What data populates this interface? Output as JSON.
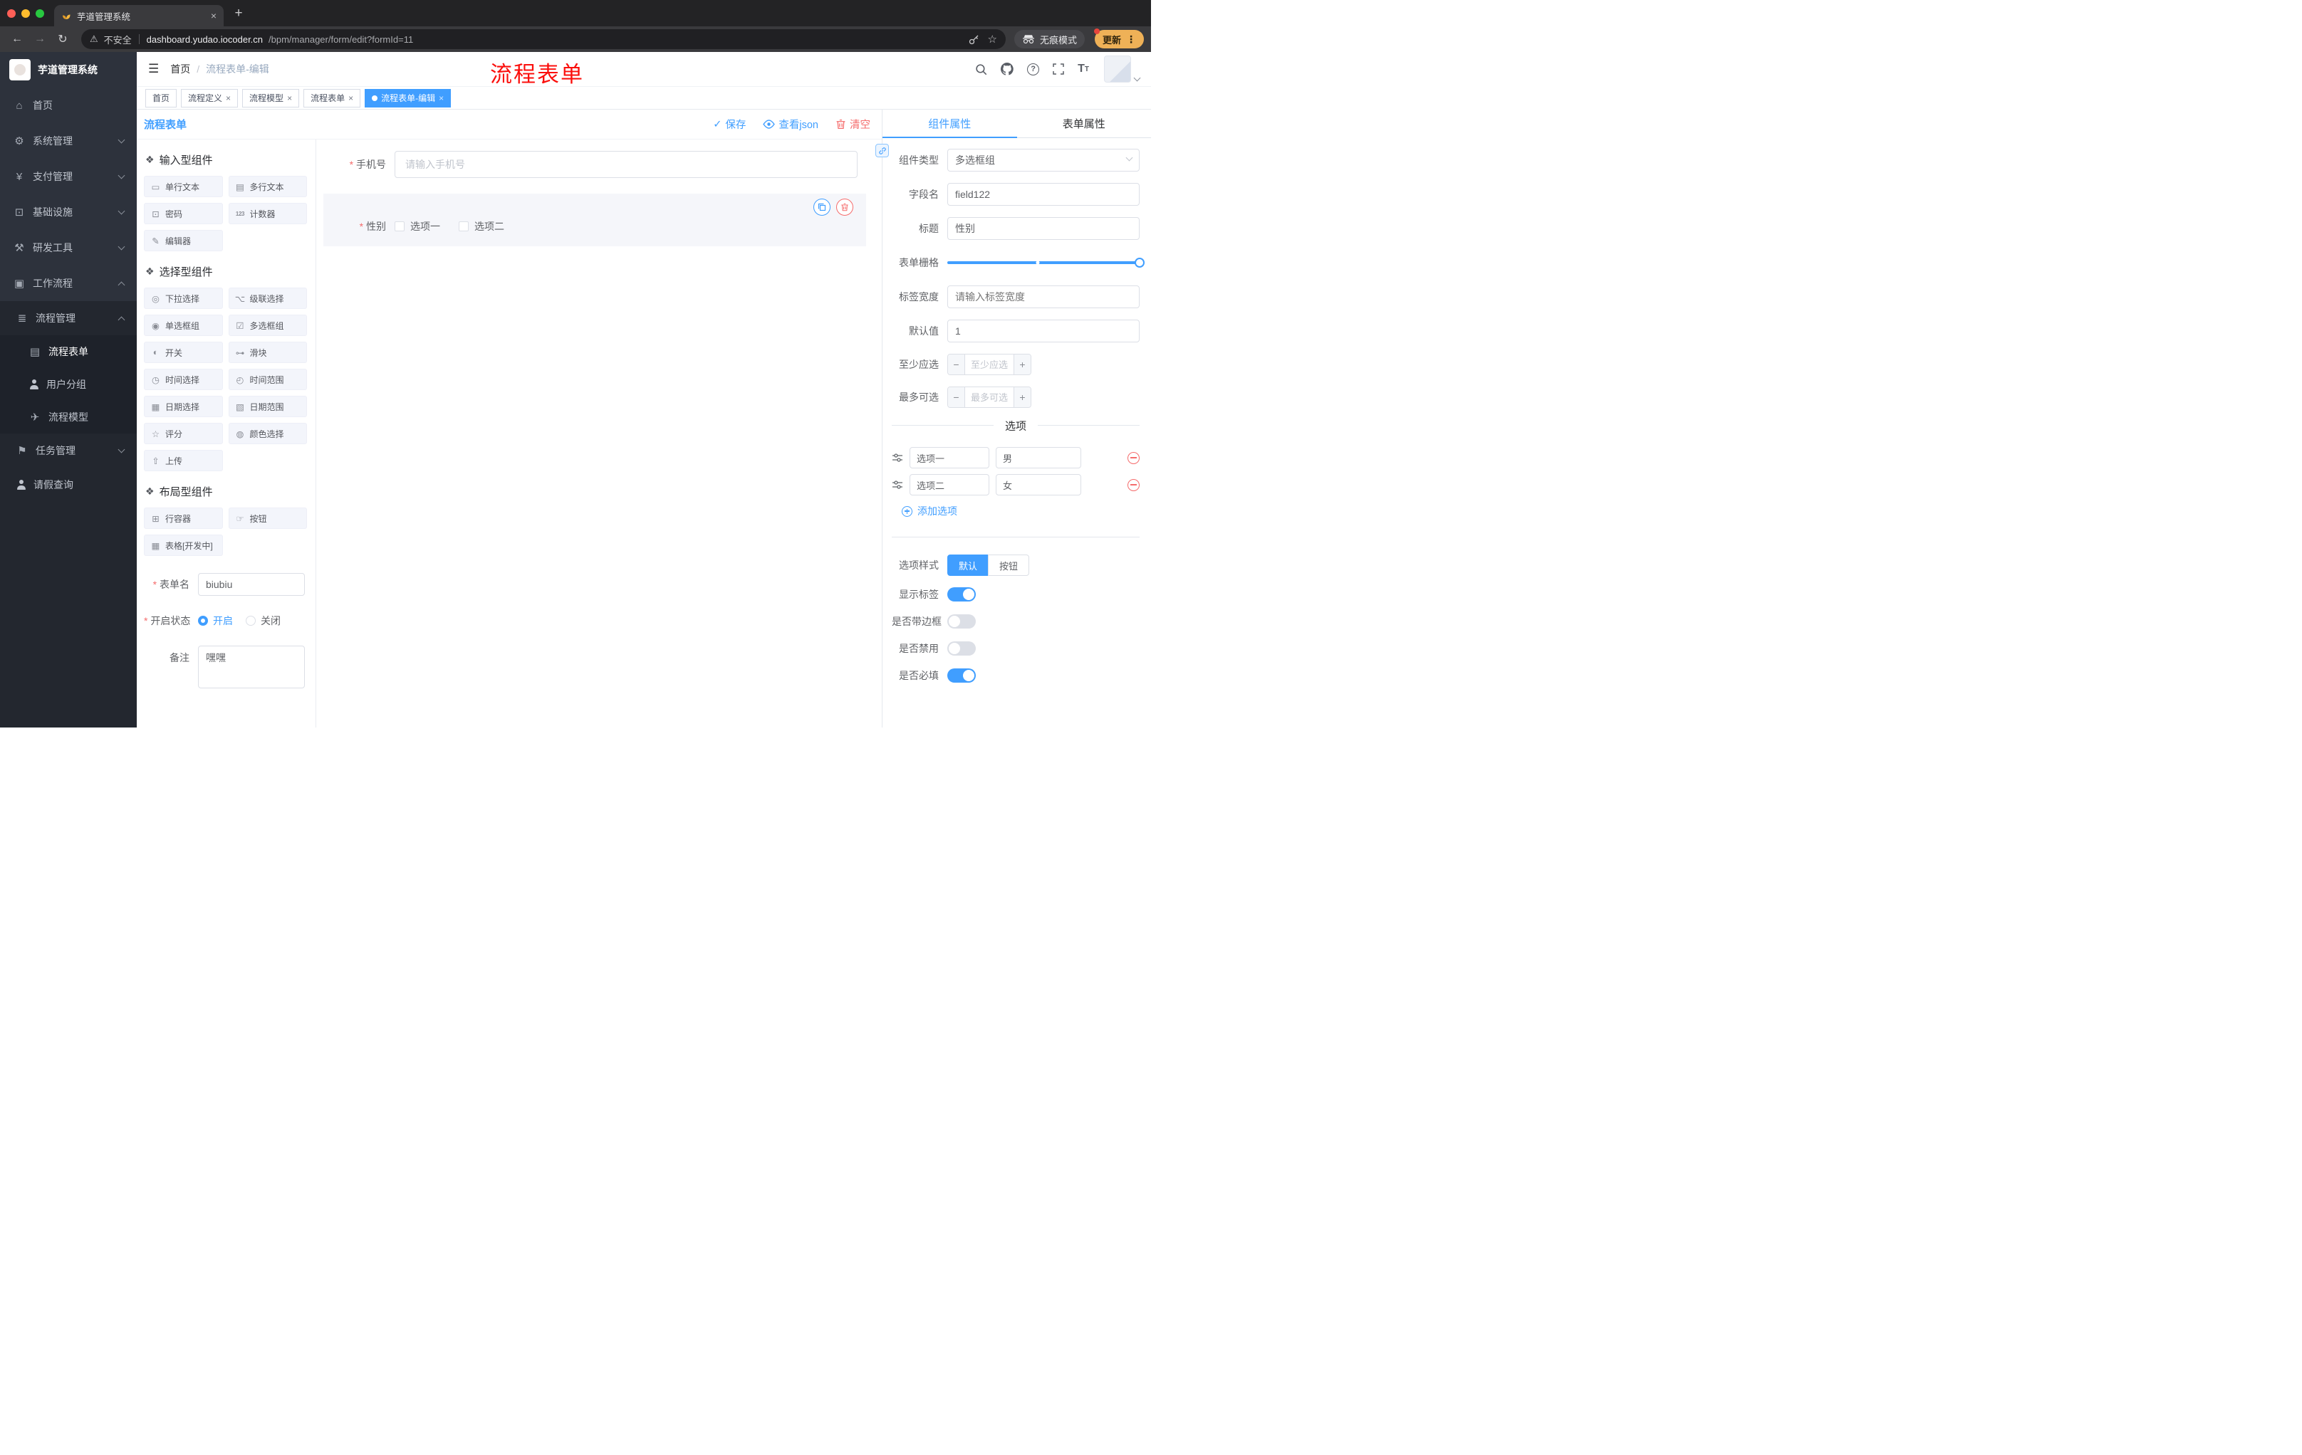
{
  "colors": {
    "accent": "#409eff",
    "danger": "#f56c6c",
    "annotation_red": "#fb0f0c",
    "sidebar_bg": "#2d323c",
    "active_tag_bg": "#409eff",
    "update_pill": "#efb157"
  },
  "browser": {
    "tab_title": "芋道管理系统",
    "security_label": "不安全",
    "url_domain": "dashboard.yudao.iocoder.cn",
    "url_path": "/bpm/manager/form/edit?formId=11",
    "incognito_label": "无痕模式",
    "update_label": "更新"
  },
  "sidebar": {
    "title": "芋道管理系统",
    "items": [
      {
        "label": "首页"
      },
      {
        "label": "系统管理"
      },
      {
        "label": "支付管理"
      },
      {
        "label": "基础设施"
      },
      {
        "label": "研发工具"
      },
      {
        "label": "工作流程"
      }
    ],
    "submenu": {
      "label": "流程管理",
      "children": [
        {
          "label": "流程表单"
        },
        {
          "label": "用户分组"
        },
        {
          "label": "流程模型"
        }
      ]
    },
    "tail": [
      {
        "label": "任务管理"
      },
      {
        "label": "请假查询"
      }
    ]
  },
  "header": {
    "breadcrumb": [
      "首页",
      "流程表单-编辑"
    ],
    "annotation": "流程表单"
  },
  "tags": [
    {
      "label": "首页"
    },
    {
      "label": "流程定义"
    },
    {
      "label": "流程模型"
    },
    {
      "label": "流程表单"
    },
    {
      "label": "流程表单-编辑"
    }
  ],
  "designer": {
    "title": "流程表单",
    "actions": {
      "save": "保存",
      "view_json": "查看json",
      "clear": "清空"
    },
    "palette": {
      "groups": [
        {
          "title": "输入型组件",
          "items": [
            "单行文本",
            "多行文本",
            "密码",
            "计数器",
            "编辑器"
          ]
        },
        {
          "title": "选择型组件",
          "items": [
            "下拉选择",
            "级联选择",
            "单选框组",
            "多选框组",
            "开关",
            "滑块",
            "时间选择",
            "时间范围",
            "日期选择",
            "日期范围",
            "评分",
            "颜色选择",
            "上传"
          ]
        },
        {
          "title": "布局型组件",
          "items": [
            "行容器",
            "按钮",
            "表格[开发中]"
          ]
        }
      ]
    },
    "meta": {
      "name_label": "表单名",
      "name_value": "biubiu",
      "status_label": "开启状态",
      "status_on": "开启",
      "status_off": "关闭",
      "remark_label": "备注",
      "remark_value": "嘿嘿"
    },
    "canvas": {
      "phone_label": "手机号",
      "phone_placeholder": "请输入手机号",
      "gender_label": "性别",
      "gender_options": [
        "选项一",
        "选项二"
      ]
    }
  },
  "props": {
    "tabs": [
      "组件属性",
      "表单属性"
    ],
    "rows": {
      "type_label": "组件类型",
      "type_value": "多选框组",
      "field_label": "字段名",
      "field_value": "field122",
      "title_label": "标题",
      "title_value": "性别",
      "grid_label": "表单栅格",
      "width_label": "标签宽度",
      "width_placeholder": "请输入标签宽度",
      "default_label": "默认值",
      "default_value": "1",
      "min_label": "至少应选",
      "min_placeholder": "至少应选",
      "max_label": "最多可选",
      "max_placeholder": "最多可选"
    },
    "options": {
      "title": "选项",
      "rows": [
        {
          "name": "选项一",
          "value": "男"
        },
        {
          "name": "选项二",
          "value": "女"
        }
      ],
      "add_label": "添加选项"
    },
    "style": {
      "label": "选项样式",
      "options": [
        "默认",
        "按钮"
      ]
    },
    "switches": [
      {
        "label": "显示标签",
        "on": true
      },
      {
        "label": "是否带边框",
        "on": false
      },
      {
        "label": "是否禁用",
        "on": false
      },
      {
        "label": "是否必填",
        "on": true
      }
    ]
  }
}
